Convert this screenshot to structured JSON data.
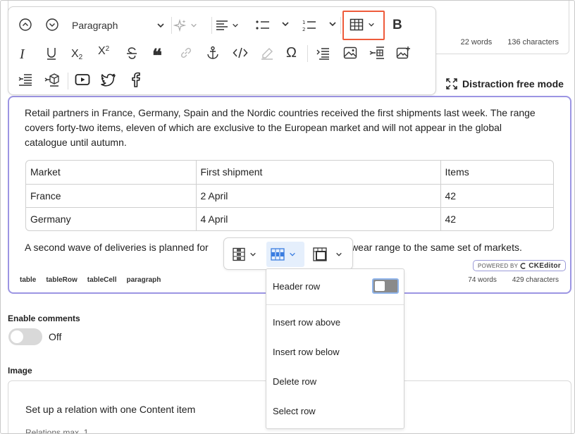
{
  "top_field": {
    "words": "22 words",
    "characters": "136 characters"
  },
  "toolbar": {
    "heading_dropdown": "Paragraph",
    "icons": [
      "chevron-up-circle-icon",
      "chevron-down-circle-icon",
      "ai-sparkle-icon",
      "align-left-icon",
      "bulleted-list-icon",
      "numbered-list-icon",
      "table-icon",
      "bold-icon",
      "italic-icon",
      "underline-icon",
      "subscript-icon",
      "superscript-icon",
      "strikethrough-icon",
      "blockquote-icon",
      "link-icon",
      "anchor-icon",
      "code-icon",
      "highlight-icon",
      "special-characters-icon",
      "insert-paragraph-icon",
      "image-icon",
      "insert-block-icon",
      "replace-image-icon",
      "indent-icon",
      "insert-item-icon",
      "youtube-icon",
      "twitter-icon",
      "facebook-icon"
    ]
  },
  "distraction_free": "Distraction free mode",
  "editor": {
    "paragraph1": "Retail partners in France, Germany, Spain and the Nordic countries received the first shipments last week. The range covers forty-two items, eleven of which are exclusive to the European market and will not appear in the global catalogue until autumn.",
    "table": [
      [
        "Market",
        "First shipment",
        "Items"
      ],
      [
        "France",
        "2 April",
        "42"
      ],
      [
        "Germany",
        "4 April",
        "42"
      ]
    ],
    "paragraph2_start": "A second wave of deliveries is planned for ",
    "paragraph2_end": "ootwear range to the same set of markets.",
    "path": [
      "table",
      "tableRow",
      "tableCell",
      "paragraph"
    ],
    "words": "74 words",
    "characters": "429 characters",
    "powered_by": "POWERED BY",
    "powered_brand": "CKEditor"
  },
  "row_menu": {
    "header_row": "Header row",
    "insert_above": "Insert row above",
    "insert_below": "Insert row below",
    "delete": "Delete row",
    "select": "Select row"
  },
  "comments": {
    "label": "Enable comments",
    "state": "Off"
  },
  "image": {
    "label": "Image",
    "relation_title": "Set up a relation with one Content item",
    "relation_sub": "Relations max. 1"
  },
  "colors": {
    "accent": "#9c95e3",
    "highlight": "#ee5b3b",
    "active": "#3a7de0"
  }
}
